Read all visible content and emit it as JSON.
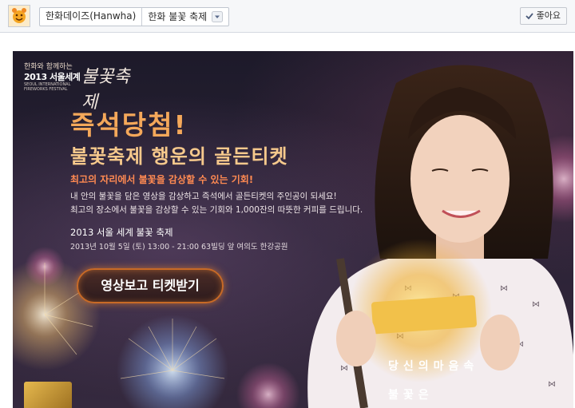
{
  "header": {
    "page_name": "한화데이즈(Hanwha)",
    "app_name": "한화 불꽃 축제",
    "like_label": "좋아요"
  },
  "banner": {
    "logo": {
      "line1": "한화와 함께하는",
      "line2": "2013 서울세계",
      "script": "불꽃축제",
      "small": "SEOUL INTERNATIONAL FIREWORKS FESTIVAL"
    },
    "headline": "즉석당첨!",
    "subheadline": "불꽃축제 행운의 골든티켓",
    "tagline": "최고의 자리에서 불꽃을 감상할 수 있는 기회!",
    "description": [
      "내 안의 불꽃을 담은 영상을 감상하고 즉석에서 골든티켓의 주인공이 되세요!",
      "최고의 장소에서 불꽃을 감상할 수 있는 기회와 1,000잔의 따뜻한 커피를 드립니다."
    ],
    "event_title": "2013 서울 세계 불꽃 축제",
    "event_datetime": "2013년 10월 5일 (토) 13:00 - 21:00 63빌딩 앞 여의도 한강공원",
    "cta_label": "영상보고 티켓받기",
    "caption_line1": "당신의마음속",
    "caption_line2": "불꽃은"
  },
  "colors": {
    "headline": "#f4a85a",
    "tagline": "#ff8a52",
    "cta_border": "#c86a26",
    "banner_bg": "#231d2d"
  }
}
